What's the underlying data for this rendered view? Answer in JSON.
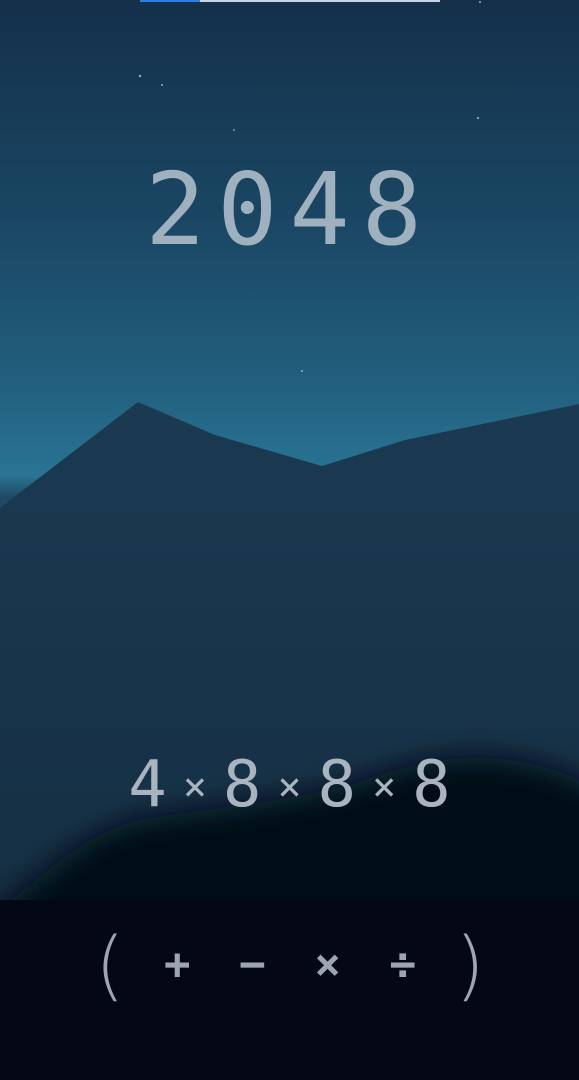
{
  "game": {
    "target": "2048",
    "progress_fraction": 0.2,
    "expression": {
      "tokens": [
        {
          "type": "number",
          "text": "4"
        },
        {
          "type": "operator",
          "text": "×"
        },
        {
          "type": "number",
          "text": "8"
        },
        {
          "type": "operator",
          "text": "×"
        },
        {
          "type": "number",
          "text": "8"
        },
        {
          "type": "operator",
          "text": "×"
        },
        {
          "type": "number",
          "text": "8"
        }
      ]
    },
    "operators": {
      "open_paren": "(",
      "plus": "+",
      "minus": "−",
      "multiply": "×",
      "divide": "÷",
      "close_paren": ")"
    }
  },
  "colors": {
    "sky_top": "#14304a",
    "sky_horizon": "#2a7494",
    "mountain": "#1b3a52",
    "foreground_hill": "#030814",
    "text": "#9fb0bf",
    "progress_fill": "#2f7fe0"
  }
}
